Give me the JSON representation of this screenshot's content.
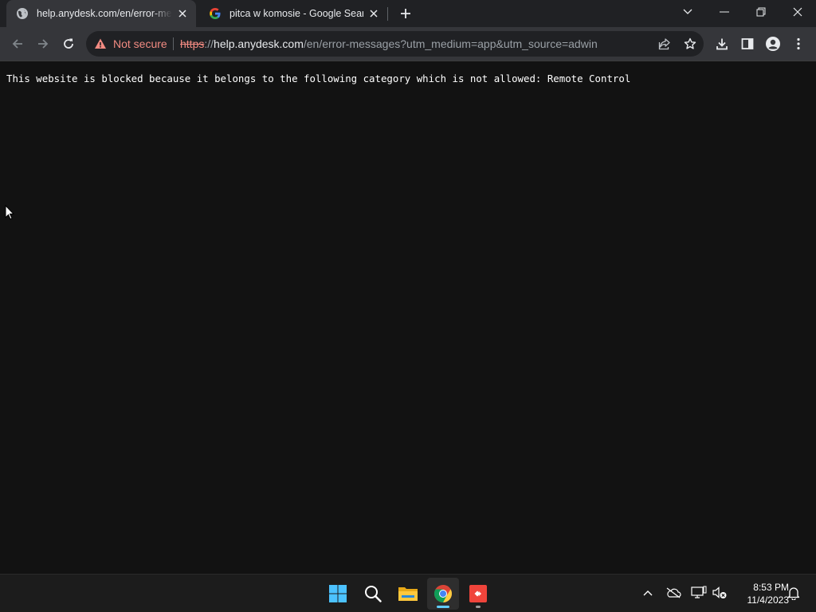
{
  "tabs": [
    {
      "title": "help.anydesk.com/en/error-messages",
      "active": true,
      "favicon": "globe-icon"
    },
    {
      "title": "pitca w komosie - Google Search",
      "active": false,
      "favicon": "google-g-icon"
    }
  ],
  "address_bar": {
    "security_label": "Not secure",
    "url_scheme": "https",
    "url_separator": "://",
    "url_host": "help.anydesk.com",
    "url_path": "/en/error-messages?utm_medium=app&utm_source=adwin"
  },
  "page": {
    "message": "This website is blocked because it belongs to the following category which is not allowed: Remote Control"
  },
  "taskbar": {
    "apps": [
      "windows-start-icon",
      "search-icon",
      "file-explorer-icon",
      "chrome-icon",
      "anydesk-icon"
    ]
  },
  "tray": {
    "time": "8:53 PM",
    "date": "11/4/2023"
  },
  "colors": {
    "tab_strip": "#202124",
    "toolbar": "#35363a",
    "omnibox": "#202124",
    "page_bg": "#121212",
    "not_secure": "#f28b82",
    "taskbar": "#1c1c1c"
  }
}
